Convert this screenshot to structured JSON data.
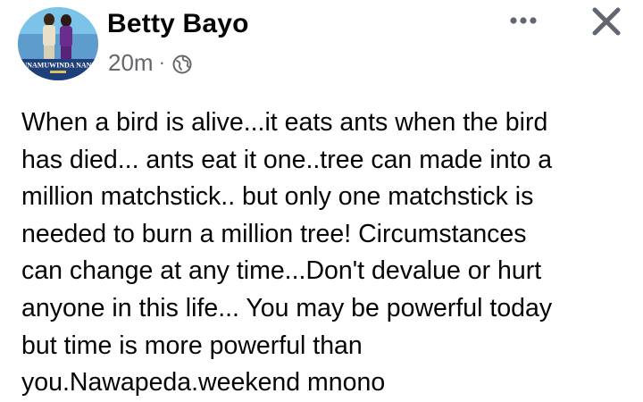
{
  "post": {
    "author": {
      "name": "Betty Bayo",
      "avatar_caption": "UNAMUWINDA NANI"
    },
    "timestamp": "20m",
    "separator": "·",
    "audience_icon": "globe-icon",
    "actions": {
      "more_icon": "more-options-icon",
      "close_icon": "close-icon"
    },
    "text": "When a bird is alive...it eats ants when the bird\nhas died... ants eat it one..tree can made into a\nmillion matchstick.. but only one matchstick is\nneeded to burn a million tree! Circumstances\ncan change at any time...Don't devalue or hurt\nanyone in this life... You may be powerful today\nbut time is more powerful than\nyou.Nawapeda.weekend mnono"
  },
  "colors": {
    "text_primary": "#050505",
    "text_secondary": "#65676b",
    "icon": "#606770",
    "background": "#ffffff"
  }
}
